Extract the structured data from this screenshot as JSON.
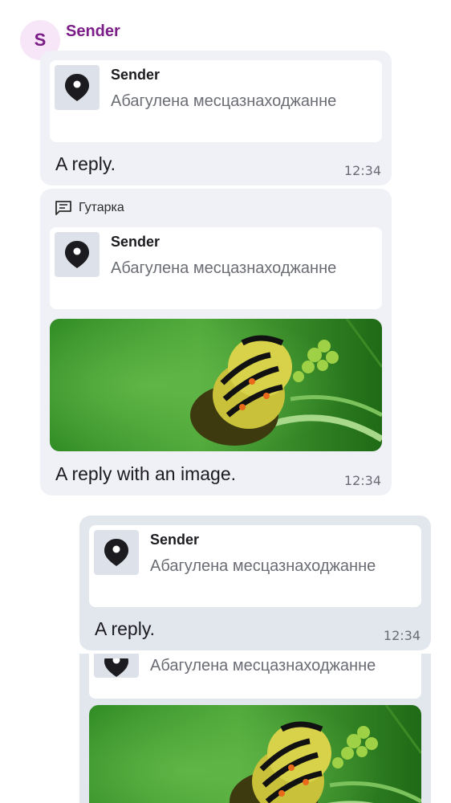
{
  "sender": {
    "avatar_letter": "S",
    "name": "Sender"
  },
  "messages": [
    {
      "quote": {
        "sender": "Sender",
        "text": "Абагулена месцазнаходжанне"
      },
      "text": "A reply.",
      "time": "12:34"
    },
    {
      "thread_label": "Гутарка",
      "quote": {
        "sender": "Sender",
        "text": "Абагулена месцазнаходжанне"
      },
      "text": "A reply with an image.",
      "time": "12:34"
    },
    {
      "quote": {
        "sender": "Sender",
        "text": "Абагулена месцазнаходжанне"
      },
      "text": "A reply.",
      "time": "12:34"
    },
    {
      "quote": {
        "text": "Абагулена месцазнаходжанне"
      }
    }
  ],
  "icons": {
    "location": "location-pin-icon",
    "thread": "thread-icon"
  },
  "colors": {
    "sender_accent": "#7b1e87",
    "incoming_bubble": "#f0f1f6",
    "outgoing_bubble": "#e2e6ed"
  }
}
